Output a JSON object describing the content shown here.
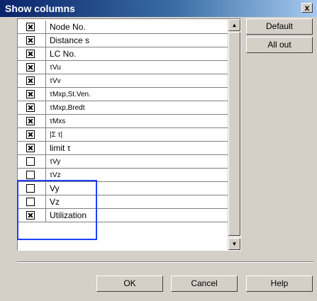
{
  "dialog": {
    "title": "Show columns",
    "close_glyph": "x"
  },
  "columns": [
    {
      "label": "Node No.",
      "checked": true
    },
    {
      "label": "Distance s",
      "checked": true
    },
    {
      "label": "LC No.",
      "checked": true
    },
    {
      "label": "τVu",
      "checked": true,
      "small": true
    },
    {
      "label": "τVv",
      "checked": true,
      "small": true
    },
    {
      "label": "τMxp,St.Ven.",
      "checked": true,
      "small": true
    },
    {
      "label": "τMxp,Bredt",
      "checked": true,
      "small": true
    },
    {
      "label": "τMxs",
      "checked": true,
      "small": true
    },
    {
      "label": "|Σ τ|",
      "checked": true,
      "small": true
    },
    {
      "label": "limit τ",
      "checked": true
    },
    {
      "label": "τVy",
      "checked": false,
      "small": true
    },
    {
      "label": "τVz",
      "checked": false,
      "small": true
    },
    {
      "label": "Vy",
      "checked": false
    },
    {
      "label": "Vz",
      "checked": false
    },
    {
      "label": "Utilization",
      "checked": true
    }
  ],
  "buttons": {
    "default": "Default",
    "all_out": "All out",
    "ok": "OK",
    "cancel": "Cancel",
    "help": "Help"
  },
  "scroll": {
    "up_glyph": "▲",
    "down_glyph": "▼"
  },
  "highlight_color": "#2040ff"
}
